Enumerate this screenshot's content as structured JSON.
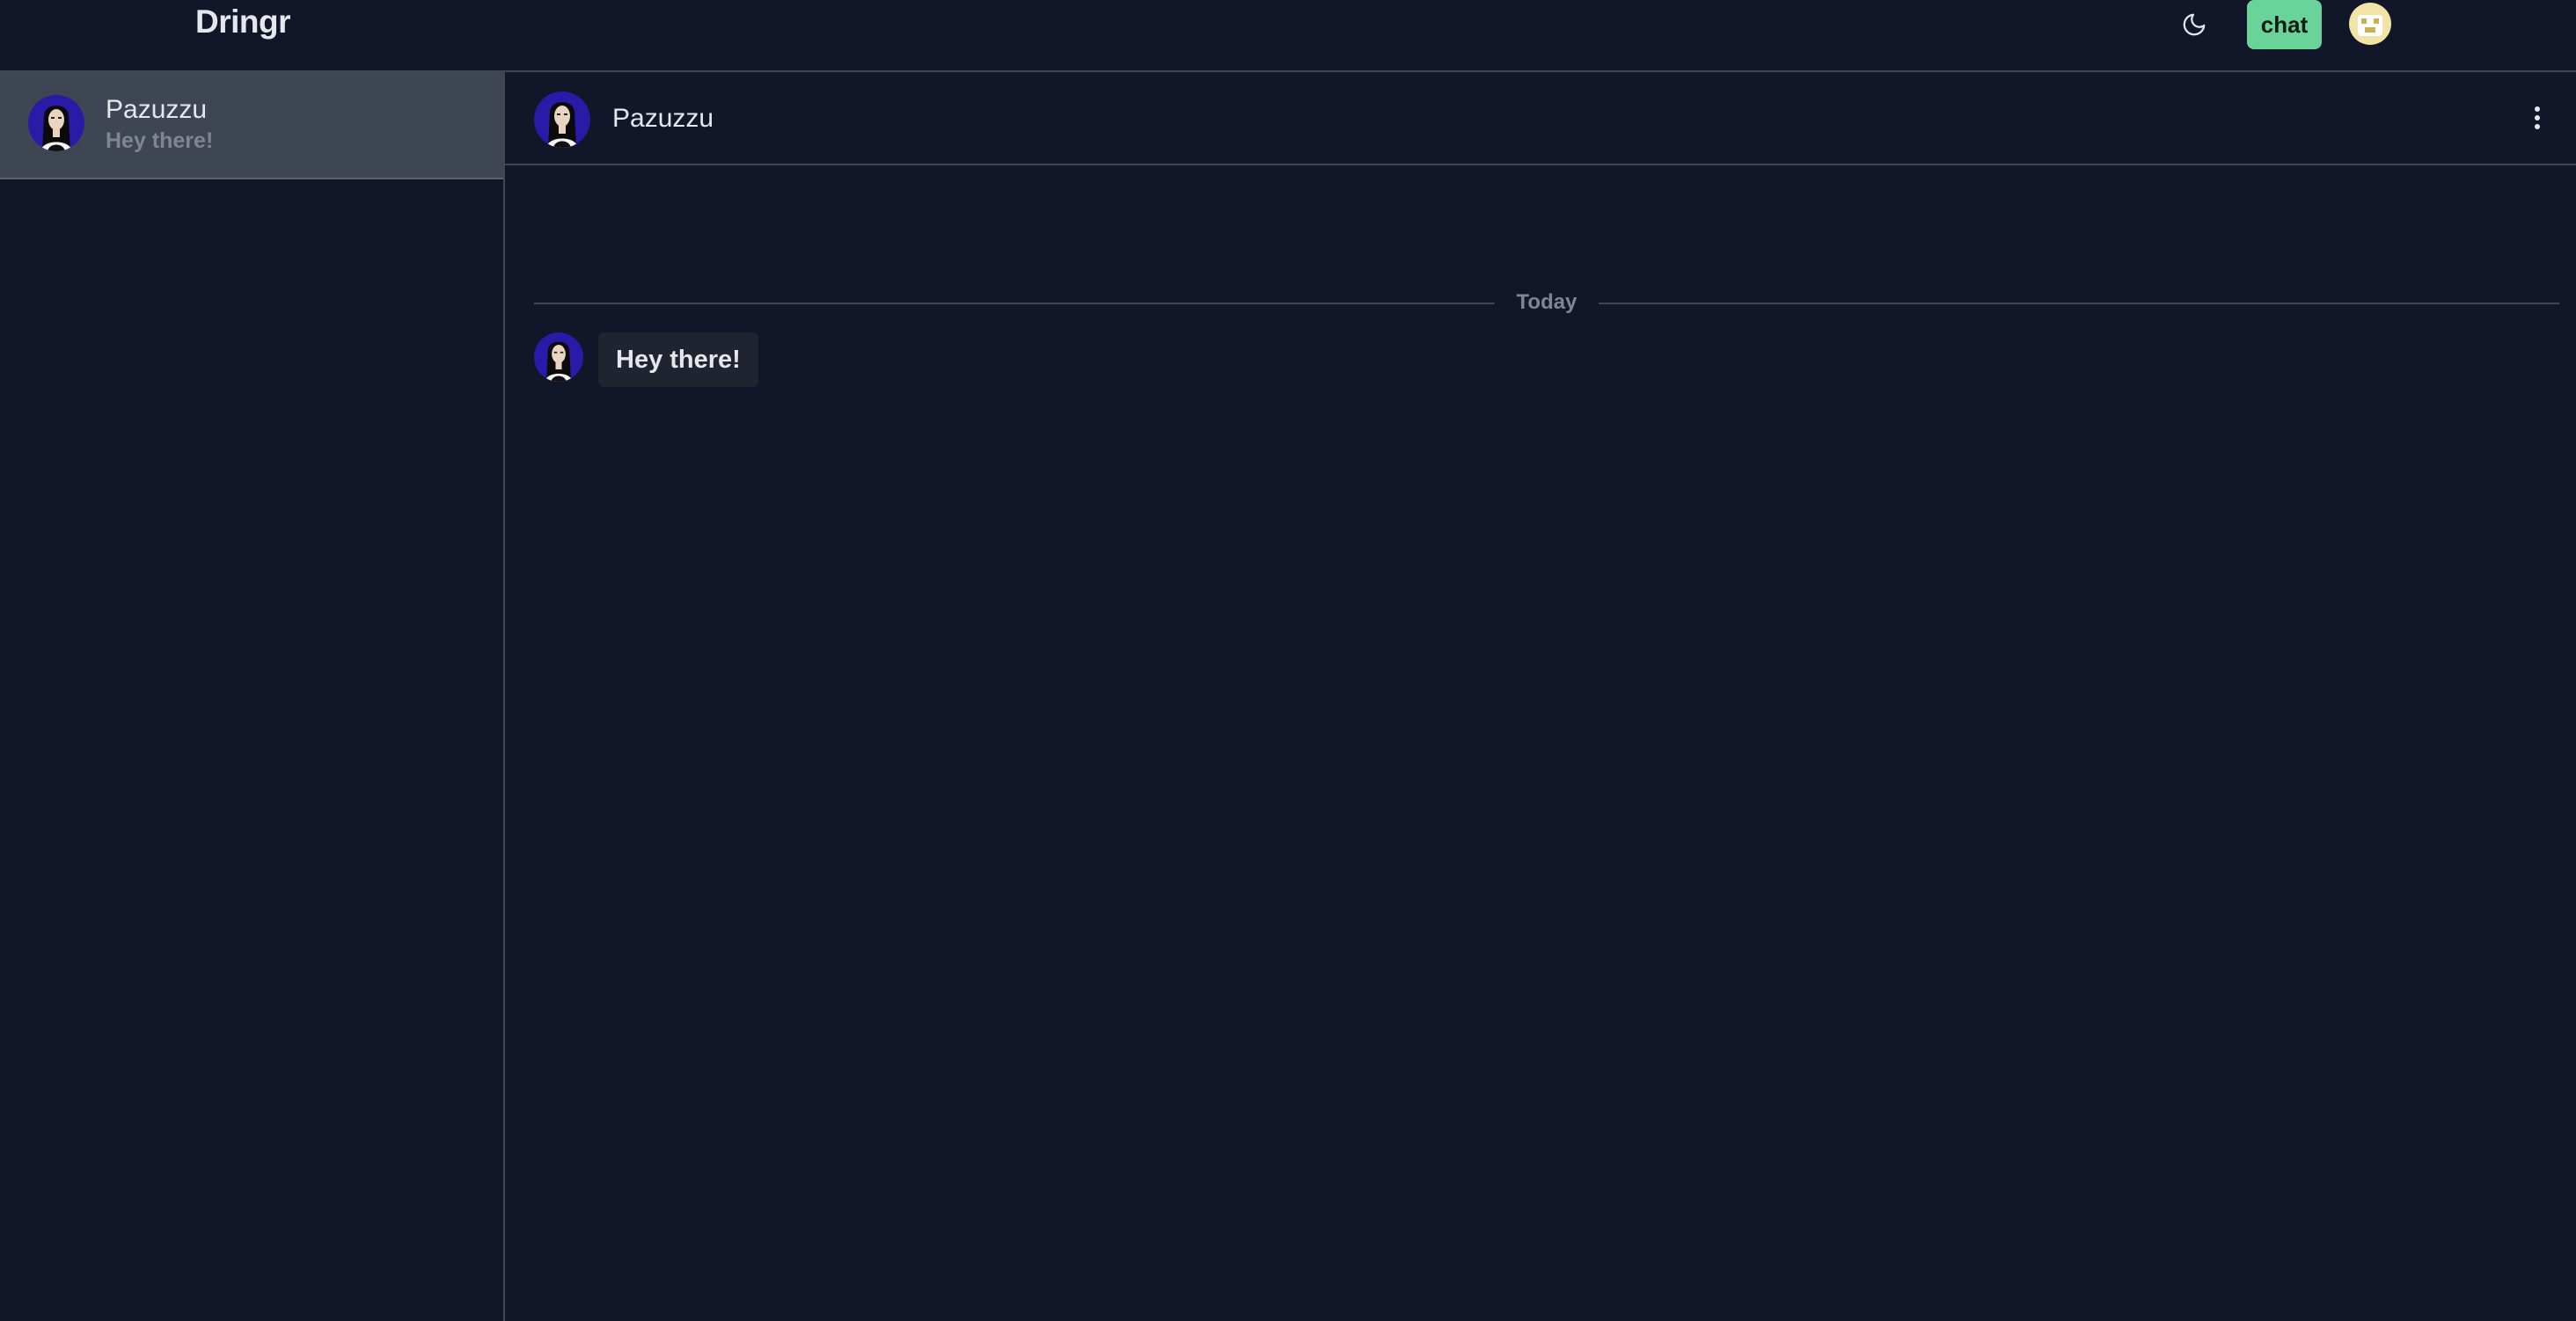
{
  "app": {
    "brand": "Dringr"
  },
  "navbar": {
    "theme_icon": "moon-icon",
    "chat_label": "chat",
    "avatar_icon": "user-avatar"
  },
  "colors": {
    "background": "#111729",
    "accent": "#6ad39a",
    "selected_item": "#3e4553",
    "border": "#404653",
    "muted_text": "#7f8592",
    "bubble": "#1f2430"
  },
  "sidebar": {
    "conversations": [
      {
        "name": "Pazuzzu",
        "preview": "Hey there!",
        "selected": true
      }
    ]
  },
  "chat": {
    "header": {
      "name": "Pazuzzu",
      "menu_icon": "more-vertical-icon"
    },
    "date_divider": "Today",
    "messages": [
      {
        "sender": "Pazuzzu",
        "text": "Hey there!"
      }
    ]
  }
}
